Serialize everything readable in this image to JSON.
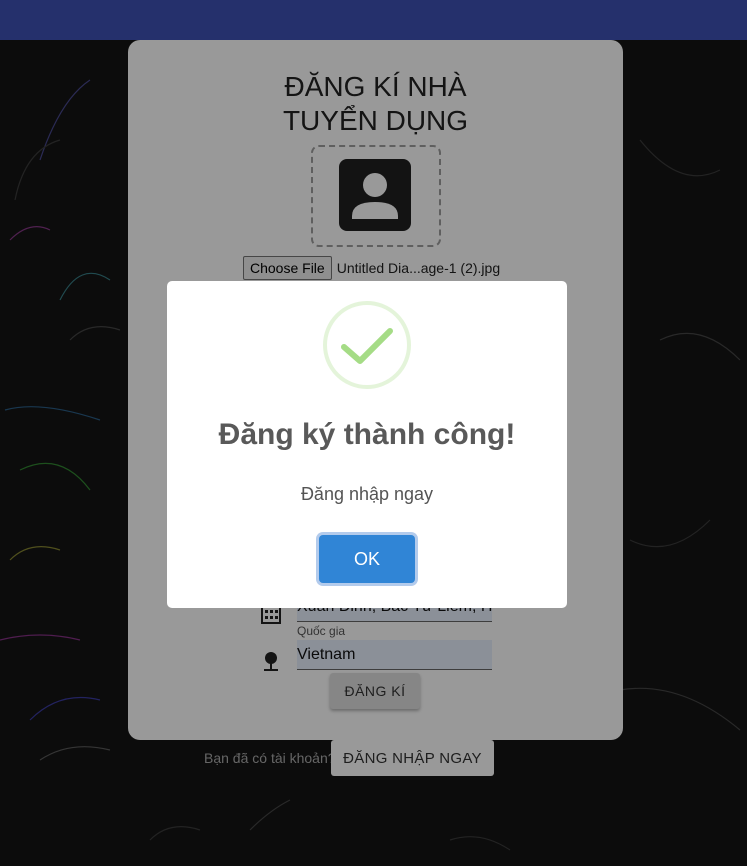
{
  "page": {
    "title_line1": "ĐĂNG KÍ NHÀ",
    "title_line2": "TUYỂN DỤNG",
    "file_button": "Choose File",
    "file_name": "Untitled Dia...age-1 (2).jpg",
    "address_value": "Xuân Đỉnh, Bắc Từ Liêm, Hà Nội",
    "country_label": "Quốc gia",
    "country_value": "Vietnam",
    "register_button": "ĐĂNG KÍ",
    "login_prompt": "Bạn đã có tài khoản?",
    "login_button": "ĐĂNG NHẬP NGAY"
  },
  "modal": {
    "title": "Đăng ký thành công!",
    "text": "Đăng nhập ngay",
    "ok_button": "OK"
  },
  "colors": {
    "topbar": "#3f51b5",
    "ok_button": "#3085d6",
    "success_check": "#a5dc86"
  }
}
